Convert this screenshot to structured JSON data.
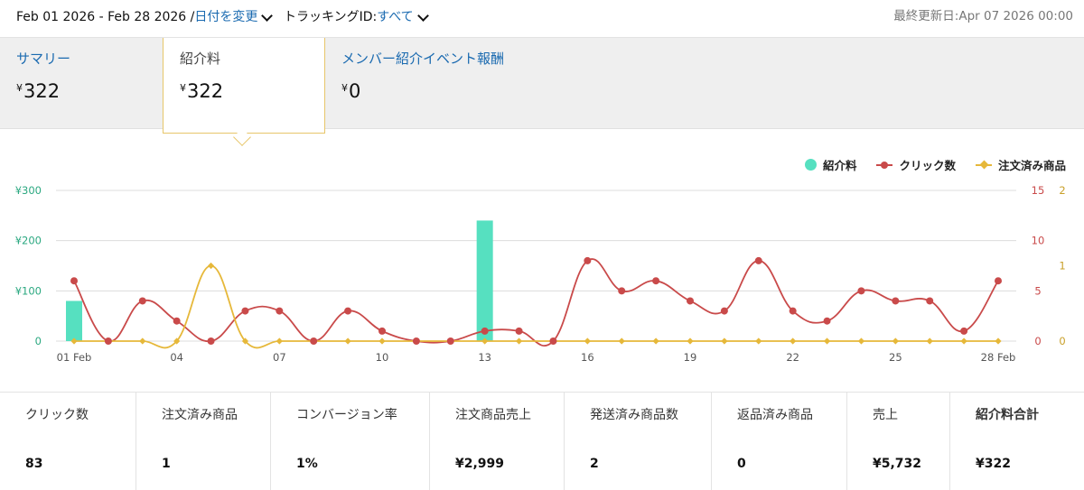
{
  "header": {
    "date_range": "Feb 01 2026 - Feb 28 2026 /",
    "change_date": "日付を変更",
    "tracking_label": "トラッキングID:",
    "tracking_value": "すべて",
    "last_updated": "最終更新日:Apr 07 2026 00:00"
  },
  "tabs": [
    {
      "label": "サマリー",
      "currency": "¥",
      "value": "322"
    },
    {
      "label": "紹介料",
      "currency": "¥",
      "value": "322"
    },
    {
      "label": "メンバー紹介イベント報酬",
      "currency": "¥",
      "value": "0"
    }
  ],
  "legend": {
    "fee": "紹介料",
    "clicks": "クリック数",
    "ordered": "注文済み商品"
  },
  "colors": {
    "fee": "#56e0c0",
    "clicks": "#c94a4a",
    "ordered": "#e6b83a",
    "link": "#1a6ab0"
  },
  "chart_data": {
    "type": "bar+line",
    "x": [
      "01",
      "02",
      "03",
      "04",
      "05",
      "06",
      "07",
      "08",
      "09",
      "10",
      "11",
      "12",
      "13",
      "14",
      "15",
      "16",
      "17",
      "18",
      "19",
      "20",
      "21",
      "22",
      "23",
      "24",
      "25",
      "26",
      "27",
      "28"
    ],
    "x_tick_labels": [
      "01 Feb",
      "04",
      "07",
      "10",
      "13",
      "16",
      "19",
      "22",
      "25",
      "28 Feb"
    ],
    "y_left": {
      "ticks": [
        "¥300",
        "¥200",
        "¥100",
        "0"
      ],
      "range": [
        0,
        300
      ]
    },
    "y_right_clicks": {
      "ticks": [
        "15",
        "10",
        "5",
        "0"
      ],
      "range": [
        0,
        15
      ]
    },
    "y_right_ordered": {
      "ticks": [
        "2",
        "1",
        "0"
      ],
      "range": [
        0,
        2
      ]
    },
    "series": [
      {
        "name": "紹介料",
        "kind": "bar",
        "values": [
          80,
          0,
          0,
          0,
          0,
          0,
          0,
          0,
          0,
          0,
          0,
          0,
          240,
          0,
          0,
          0,
          0,
          0,
          0,
          0,
          0,
          0,
          0,
          0,
          0,
          0,
          0,
          0
        ]
      },
      {
        "name": "クリック数",
        "kind": "line",
        "values": [
          6,
          0,
          4,
          2,
          0,
          3,
          3,
          0,
          3,
          1,
          0,
          0,
          1,
          1,
          0,
          8,
          5,
          6,
          4,
          3,
          8,
          3,
          2,
          5,
          4,
          4,
          1,
          6
        ]
      },
      {
        "name": "注文済み商品",
        "kind": "line",
        "values": [
          0,
          0,
          0,
          0,
          1,
          0,
          0,
          0,
          0,
          0,
          0,
          0,
          0,
          0,
          0,
          0,
          0,
          0,
          0,
          0,
          0,
          0,
          0,
          0,
          0,
          0,
          0,
          0
        ]
      }
    ]
  },
  "metrics": [
    {
      "label": "クリック数",
      "value": "83"
    },
    {
      "label": "注文済み商品",
      "value": "1"
    },
    {
      "label": "コンバージョン率",
      "value": "1%"
    },
    {
      "label": "注文商品売上",
      "value": "¥2,999"
    },
    {
      "label": "発送済み商品数",
      "value": "2"
    },
    {
      "label": "返品済み商品",
      "value": "0"
    },
    {
      "label": "売上",
      "value": "¥5,732"
    },
    {
      "label": "紹介料合計",
      "value": "¥322"
    }
  ]
}
